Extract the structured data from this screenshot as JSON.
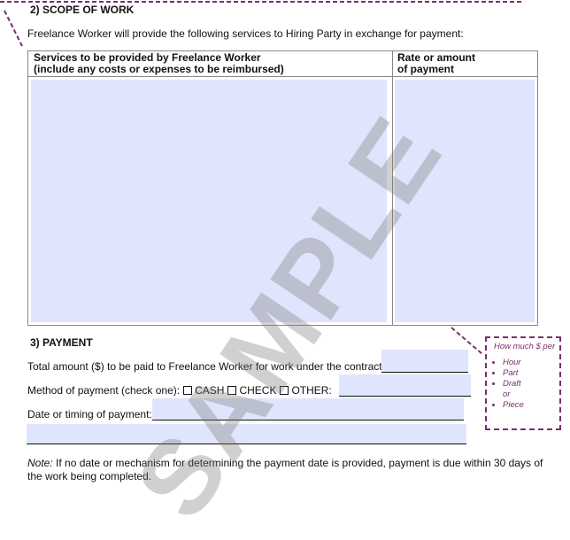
{
  "section2": {
    "heading": "2)  SCOPE OF WORK",
    "intro": "Freelance Worker will provide the following services to Hiring Party in exchange for payment:",
    "table": {
      "col1_line1": "Services to be provided by Freelance Worker",
      "col1_line2": "(include any costs or expenses to be reimbursed)",
      "col2_line1": "Rate or amount",
      "col2_line2": "of payment"
    }
  },
  "section3": {
    "heading": "3)  PAYMENT",
    "total_label": "Total amount ($) to be paid to Freelance Worker for work under the contract:",
    "method_label": "Method of payment (check one):",
    "options": [
      "CASH",
      "CHECK",
      "OTHER:"
    ],
    "date_label": "Date or timing of payment:",
    "note_label": "Note:",
    "note_text": " If no date or mechanism for determining the payment date is provided, payment is due within 30 days of",
    "note_text2": "the work being completed."
  },
  "callout": {
    "title": "How much $ per",
    "items": [
      "Hour",
      "Part",
      "Draft",
      "or",
      "Piece"
    ]
  },
  "watermark": "SAMPLE",
  "colors": {
    "field_fill": "#dfe5fc",
    "callout": "#7a2e6e"
  }
}
